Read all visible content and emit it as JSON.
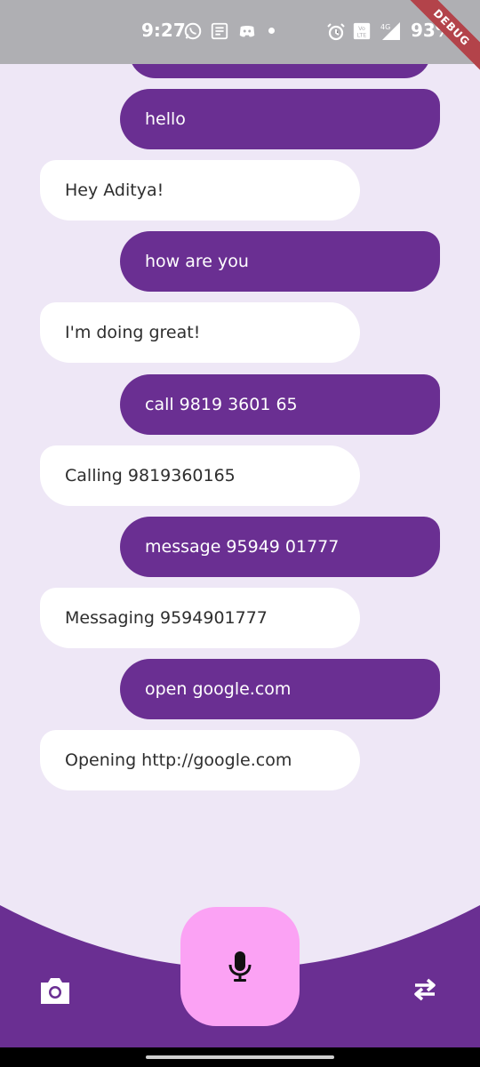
{
  "status_bar": {
    "time": "9:27",
    "battery": "93%",
    "network": "4G",
    "debug_label": "DEBUG"
  },
  "chat": {
    "messages": [
      {
        "sender": "user",
        "text": "hello"
      },
      {
        "sender": "bot",
        "text": "Hey Aditya!"
      },
      {
        "sender": "user",
        "text": "how are you"
      },
      {
        "sender": "bot",
        "text": "I'm doing great!"
      },
      {
        "sender": "user",
        "text": "call 9819 3601 65"
      },
      {
        "sender": "bot",
        "text": "Calling 9819360165"
      },
      {
        "sender": "user",
        "text": "message 95949 01777"
      },
      {
        "sender": "bot",
        "text": "Messaging 9594901777"
      },
      {
        "sender": "user",
        "text": "open google.com"
      },
      {
        "sender": "bot",
        "text": "Opening http://google.com"
      }
    ]
  },
  "controls": {
    "mic_icon": "microphone-icon",
    "camera_icon": "camera-icon",
    "swap_icon": "swap-arrows-icon"
  },
  "colors": {
    "background": "#EEE7F6",
    "user_bubble": "#6A2F92",
    "bot_bubble": "#FFFFFF",
    "bottom_bar": "#6A2F92",
    "mic_button": "#FBA2F4"
  }
}
